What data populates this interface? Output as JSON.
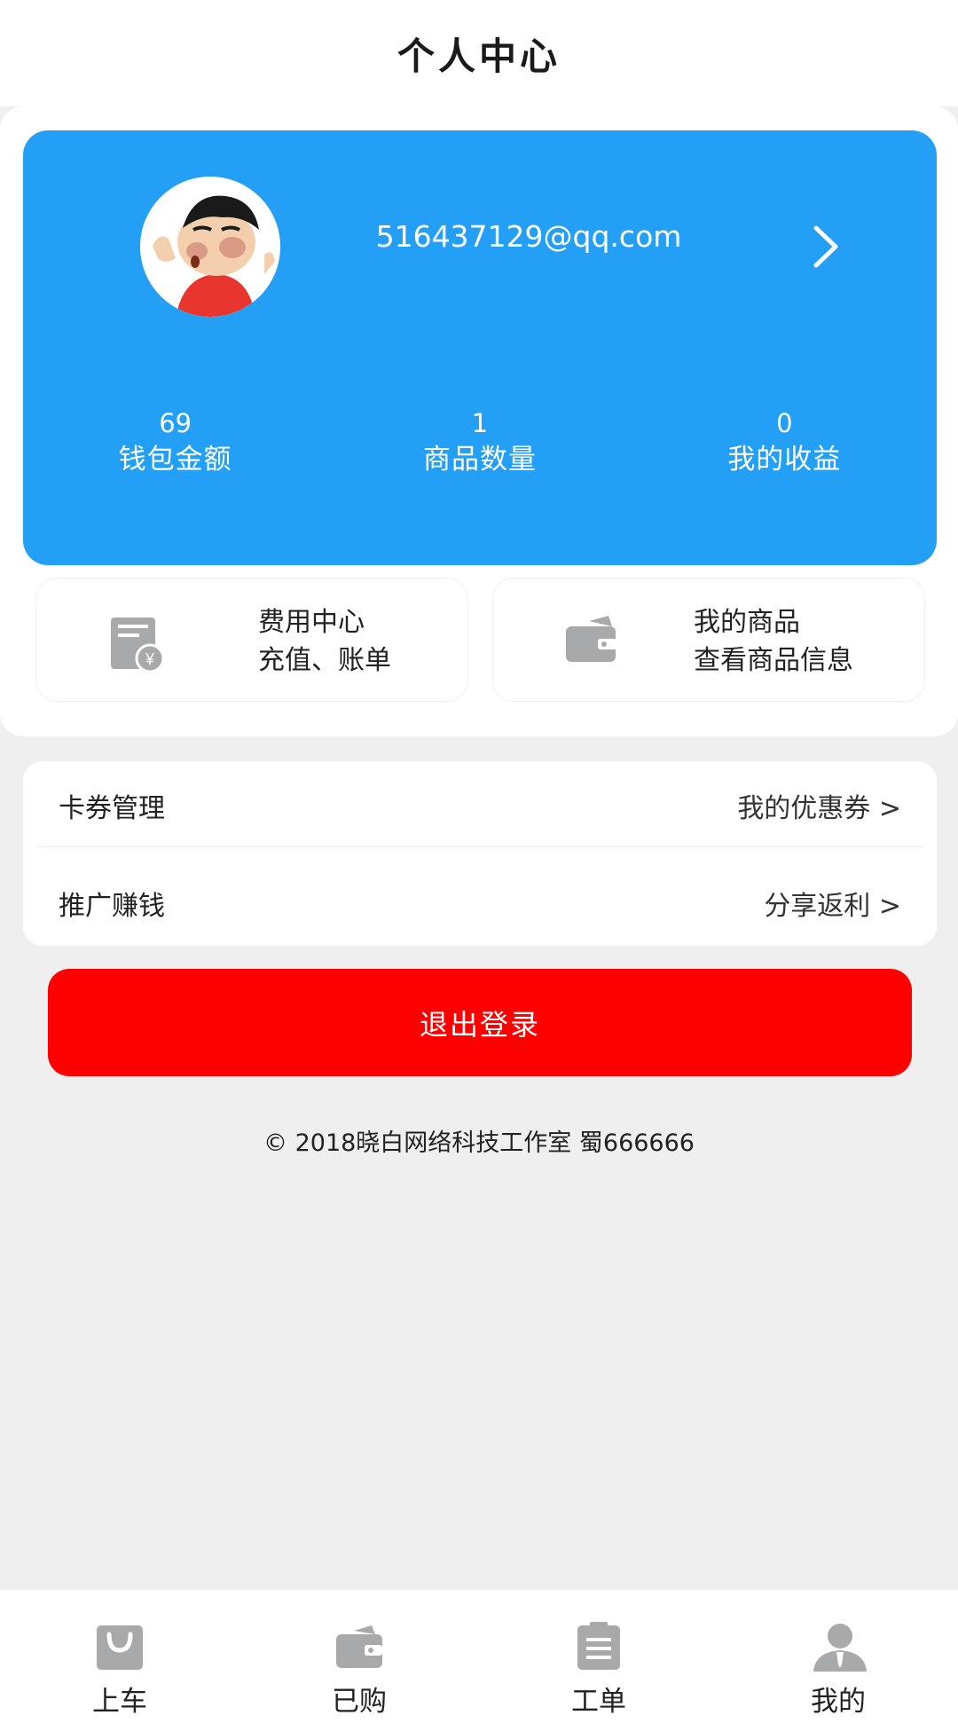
{
  "header": {
    "title": "个人中心"
  },
  "profile": {
    "email": "516437129@qq.com",
    "stats": [
      {
        "value": "69",
        "label": "钱包金额"
      },
      {
        "value": "1",
        "label": "商品数量"
      },
      {
        "value": "0",
        "label": "我的收益"
      }
    ]
  },
  "shortcuts": [
    {
      "title": "费用中心",
      "subtitle": "充值、账单",
      "icon": "bill-yen-icon"
    },
    {
      "title": "我的商品",
      "subtitle": "查看商品信息",
      "icon": "wallet-icon"
    }
  ],
  "list": [
    {
      "label": "卡券管理",
      "right": "我的优惠券 >"
    },
    {
      "label": "推广赚钱",
      "right": "分享返利 >"
    }
  ],
  "logout_label": "退出登录",
  "footer": "© 2018晓白网络科技工作室 蜀666666",
  "tabs": [
    {
      "label": "上车",
      "icon": "shopping-bag-icon"
    },
    {
      "label": "已购",
      "icon": "wallet-icon"
    },
    {
      "label": "工单",
      "icon": "clipboard-icon"
    },
    {
      "label": "我的",
      "icon": "user-icon"
    }
  ],
  "colors": {
    "accent_blue": "#239ff5",
    "logout_red": "#fd0101",
    "icon_gray": "#a8a9ab"
  }
}
